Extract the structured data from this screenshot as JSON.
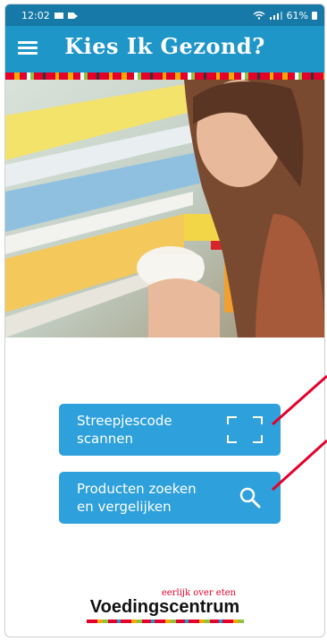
{
  "status_bar": {
    "time": "12:02",
    "battery": "61%"
  },
  "app_bar": {
    "title": "Kies Ik Gezond?",
    "menu_icon": "hamburger-menu-icon"
  },
  "hero": {
    "icon": "photo-woman-supermarket"
  },
  "actions": {
    "scan_label": "Streepjescode scannen",
    "scan_icon": "barcode-scan-icon",
    "search_label": "Producten zoeken en vergelijken",
    "search_icon": "search-icon"
  },
  "footer": {
    "tagline": "eerlijk over eten",
    "brand": "Voedingscentrum"
  },
  "colors": {
    "primary": "#1e96c8",
    "button": "#2ea0db",
    "accent_red": "#e4002b"
  }
}
